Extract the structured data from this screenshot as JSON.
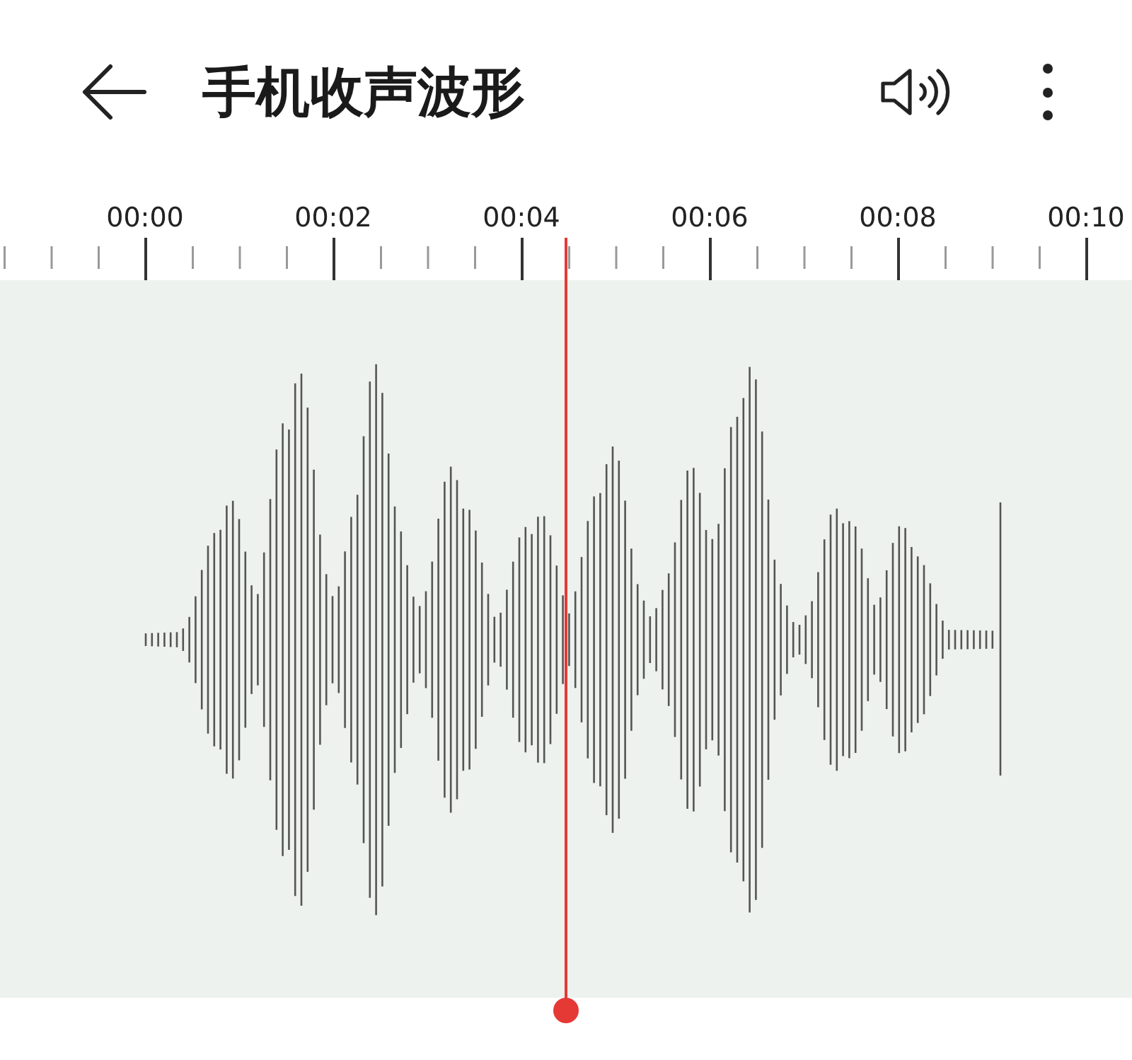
{
  "header": {
    "title": "手机收声波形"
  },
  "ruler": {
    "labels": [
      "00:00",
      "00:02",
      "00:04",
      "00:06",
      "00:08",
      "00:10"
    ]
  }
}
